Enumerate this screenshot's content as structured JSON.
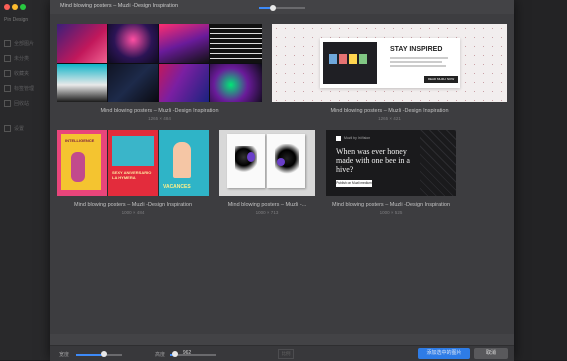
{
  "window": {
    "title": "Mind blowing posters – Muzli -Design Inspiration",
    "traffic_colors": [
      "#fc5f57",
      "#fdbc2e",
      "#28c840"
    ]
  },
  "app_sidebar": {
    "title": "Pin Design",
    "items": [
      "全部图片",
      "未分类",
      "收藏夹",
      "标签管理",
      "回收站",
      "设置"
    ]
  },
  "zoom_slider": {
    "level": 0.3
  },
  "cards": [
    {
      "caption": "Mind blowing posters – Muzli -Design Inspiration",
      "dims": "1265 × 484"
    },
    {
      "caption": "Mind blowing posters – Muzli -Design Inspiration",
      "dims": "1265 × 421",
      "inset": {
        "headline": "STAY INSPIRED",
        "button": "READ MUZLI NOW"
      }
    },
    {
      "caption": "Mind blowing posters – Muzli -Design Inspiration",
      "dims": "1000 × 484",
      "poster_texts": [
        "INTELLIGENCE",
        "SEXY ANIVERSARIO LA HYMERA",
        "VACANCES"
      ]
    },
    {
      "caption": "Mind blowing posters – Muzli -...",
      "dims": "1000 × 713"
    },
    {
      "caption": "Mind blowing posters – Muzli -Design Inspiration",
      "dims": "1000 × 525",
      "quote": "When was ever honey made with one bee in a hive?",
      "button": "Publish on Muzli medium",
      "brand": "Muzli by InVision"
    }
  ],
  "bottom_bar": {
    "width_label": "宽度",
    "width_value": "962",
    "height_label": "高度",
    "ratio_label": "比例",
    "primary_button": "添加选中的图片",
    "cancel_button": "取消",
    "width_level": 0.6,
    "height_level": 0.1
  }
}
